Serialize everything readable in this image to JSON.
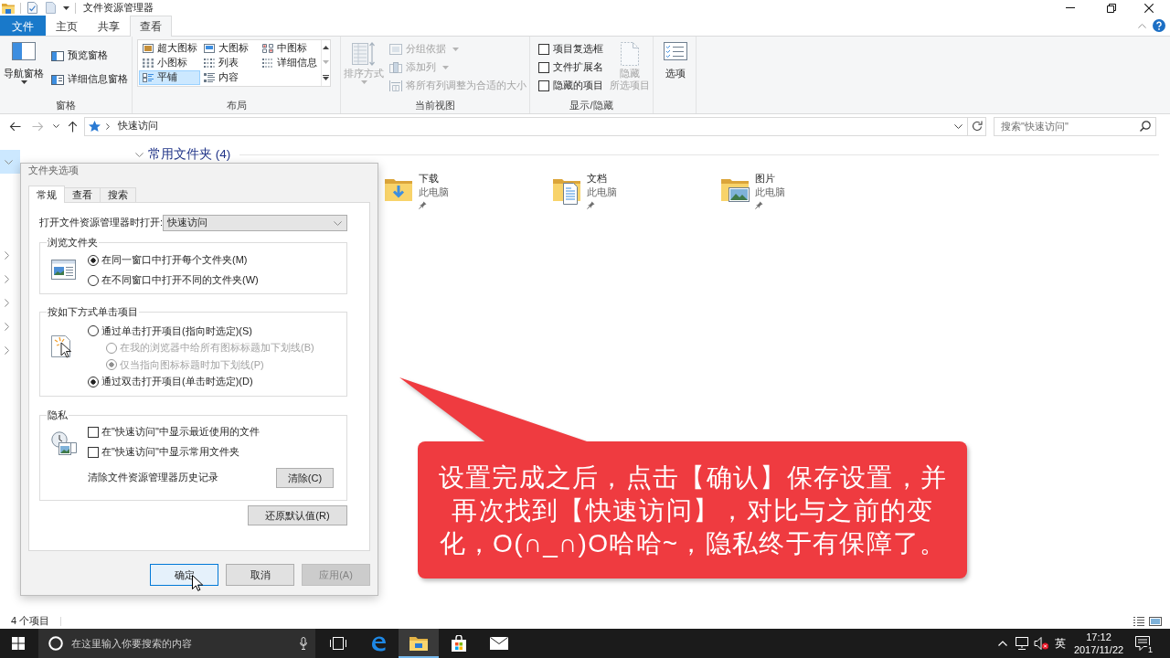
{
  "window": {
    "title": "文件资源管理器"
  },
  "ribbon": {
    "tabs": [
      {
        "label": "文件",
        "kind": "file",
        "selected": false
      },
      {
        "label": "主页",
        "kind": "tab",
        "selected": false
      },
      {
        "label": "共享",
        "kind": "tab",
        "selected": false
      },
      {
        "label": "查看",
        "kind": "tab",
        "selected": true
      }
    ],
    "panes": {
      "label": "窗格",
      "navigation_pane": "导航窗格",
      "preview_pane": "预览窗格",
      "details_pane": "详细信息窗格"
    },
    "layout": {
      "label": "布局",
      "options": [
        {
          "label": "超大图标",
          "kind": "extra_large_icons",
          "selected": false
        },
        {
          "label": "大图标",
          "kind": "large_icons",
          "selected": false
        },
        {
          "label": "中图标",
          "kind": "medium_icons",
          "selected": false
        },
        {
          "label": "小图标",
          "kind": "small_icons",
          "selected": false
        },
        {
          "label": "列表",
          "kind": "list",
          "selected": false
        },
        {
          "label": "详细信息",
          "kind": "details",
          "selected": false
        },
        {
          "label": "平铺",
          "kind": "tiles",
          "selected": true
        },
        {
          "label": "内容",
          "kind": "content",
          "selected": false
        }
      ]
    },
    "current_view": {
      "label": "当前视图",
      "sort_by": {
        "label": "排序方式",
        "disabled": true
      },
      "commands": [
        {
          "label": "分组依据",
          "kind": "group_by",
          "has_menu": true,
          "disabled": true
        },
        {
          "label": "添加列",
          "kind": "add_columns",
          "has_menu": true,
          "disabled": true
        },
        {
          "label": "将所有列调整为合适的大小",
          "kind": "fit_columns",
          "has_menu": false,
          "disabled": true
        }
      ]
    },
    "show_hide": {
      "label": "显示/隐藏",
      "checkboxes": [
        {
          "label": "项目复选框",
          "checked": false
        },
        {
          "label": "文件扩展名",
          "checked": false
        },
        {
          "label": "隐藏的项目",
          "checked": false
        }
      ],
      "hide_selected": {
        "label_lines": [
          "隐藏",
          "所选项目"
        ],
        "disabled": true
      }
    },
    "options": {
      "label": "选项"
    }
  },
  "address_bar": {
    "nav_buttons": [
      {
        "kind": "back",
        "disabled": false
      },
      {
        "kind": "forward",
        "disabled": true
      },
      {
        "kind": "recent",
        "disabled": false
      },
      {
        "kind": "up",
        "disabled": false
      }
    ],
    "path": [
      "快速访问"
    ],
    "search_placeholder": "搜索\"快速访问\""
  },
  "navigation_pane": {
    "items": [
      {
        "expanded": true,
        "selected": true
      },
      {
        "expanded": false,
        "selected": false
      },
      {
        "expanded": false,
        "selected": false
      },
      {
        "expanded": false,
        "selected": false
      },
      {
        "expanded": false,
        "selected": false
      },
      {
        "expanded": false,
        "selected": false
      }
    ]
  },
  "content": {
    "group": {
      "label": "常用文件夹 (4)",
      "expanded": true
    },
    "items": [
      {
        "name": "下载",
        "location": "此电脑",
        "kind": "downloads",
        "pinned": true
      },
      {
        "name": "文档",
        "location": "此电脑",
        "kind": "documents",
        "pinned": true
      },
      {
        "name": "图片",
        "location": "此电脑",
        "kind": "pictures",
        "pinned": true
      }
    ]
  },
  "status_bar": {
    "item_count": "4 个项目"
  },
  "dialog": {
    "title": "文件夹选项",
    "tabs": [
      {
        "label": "常规",
        "selected": true
      },
      {
        "label": "查看",
        "selected": false
      },
      {
        "label": "搜索",
        "selected": false
      }
    ],
    "open_in": {
      "label": "打开文件资源管理器时打开:",
      "value": "快速访问"
    },
    "groups": [
      {
        "kind": "browse",
        "legend": "浏览文件夹",
        "options": [
          {
            "kind": "radio",
            "label": "在同一窗口中打开每个文件夹(M)",
            "selected": true,
            "disabled": false
          },
          {
            "kind": "radio",
            "label": "在不同窗口中打开不同的文件夹(W)",
            "selected": false,
            "disabled": false
          }
        ]
      },
      {
        "kind": "click",
        "legend": "按如下方式单击项目",
        "options": [
          {
            "kind": "radio",
            "label": "通过单击打开项目(指向时选定)(S)",
            "selected": false,
            "disabled": false,
            "children": [
              {
                "kind": "radio",
                "label": "在我的浏览器中给所有图标标题加下划线(B)",
                "selected": false,
                "disabled": true
              },
              {
                "kind": "radio",
                "label": "仅当指向图标标题时加下划线(P)",
                "selected": true,
                "disabled": true
              }
            ]
          },
          {
            "kind": "radio",
            "label": "通过双击打开项目(单击时选定)(D)",
            "selected": true,
            "disabled": false
          }
        ]
      },
      {
        "kind": "privacy",
        "legend": "隐私",
        "options": [
          {
            "kind": "checkbox",
            "label": "在\"快速访问\"中显示最近使用的文件",
            "checked": false
          },
          {
            "kind": "checkbox",
            "label": "在\"快速访问\"中显示常用文件夹",
            "checked": false
          }
        ],
        "clear": {
          "label": "清除文件资源管理器历史记录",
          "button": "清除(C)"
        }
      }
    ],
    "restore_button": "还原默认值(R)",
    "buttons": [
      {
        "label": "确定",
        "focused": true,
        "disabled": false
      },
      {
        "label": "取消",
        "focused": false,
        "disabled": false
      },
      {
        "label": "应用(A)",
        "focused": false,
        "disabled": true
      }
    ]
  },
  "callout": {
    "text": "设置完成之后，点击【确认】保存设置，并再次找到【快速访问】，对比与之前的变化，O(∩_∩)O哈哈~，隐私终于有保障了。"
  },
  "taskbar": {
    "search_placeholder": "在这里输入你要搜索的内容",
    "apps": [
      {
        "kind": "task_view",
        "active": false
      },
      {
        "kind": "edge",
        "active": false
      },
      {
        "kind": "explorer",
        "active": true
      },
      {
        "kind": "store",
        "active": false
      },
      {
        "kind": "mail",
        "active": false
      }
    ],
    "tray": {
      "input_language": "英",
      "time": "17:12",
      "date": "2017/11/22",
      "notification_count": "1"
    }
  }
}
